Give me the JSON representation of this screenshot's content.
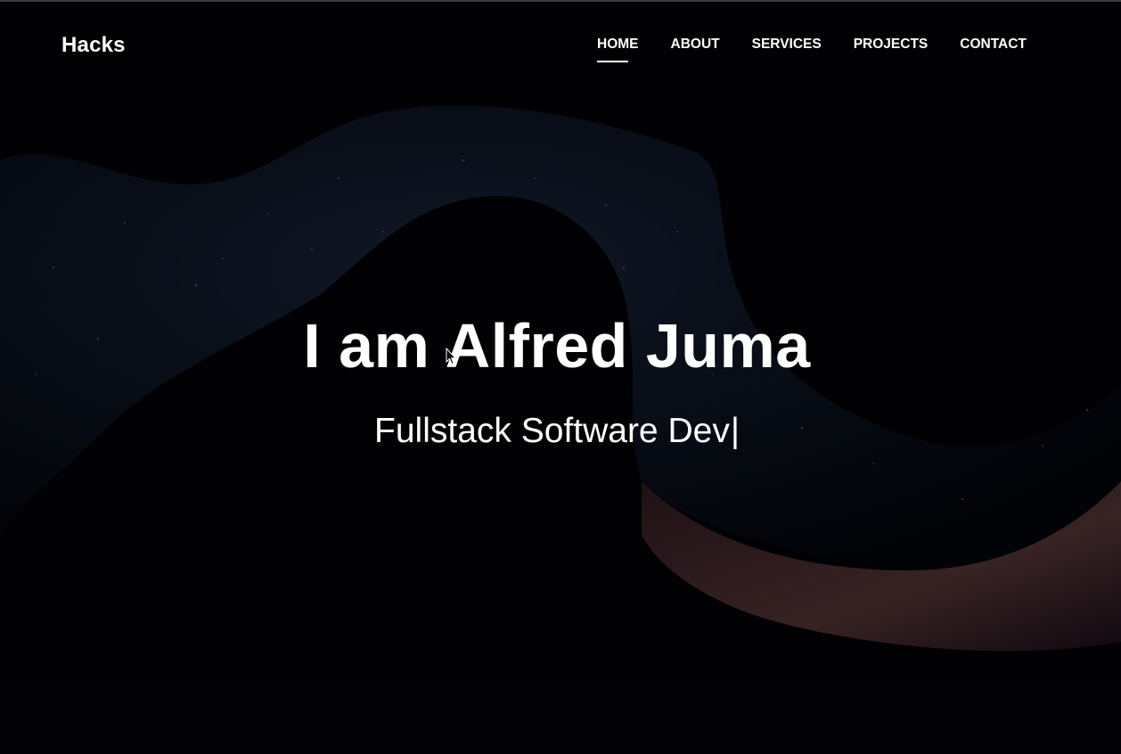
{
  "navbar": {
    "brand": "Hacks",
    "links": [
      {
        "label": "HOME",
        "active": true
      },
      {
        "label": "ABOUT",
        "active": false
      },
      {
        "label": "SERVICES",
        "active": false
      },
      {
        "label": "PROJECTS",
        "active": false
      },
      {
        "label": "CONTACT",
        "active": false
      }
    ]
  },
  "hero": {
    "title": "I am Alfred Juma",
    "typed_text": "Fullstack Software Dev",
    "cursor_glyph": "|"
  },
  "colors": {
    "text": "#ffffff",
    "background": "#050409",
    "overlay": "rgba(0,0,0,0.65)"
  }
}
